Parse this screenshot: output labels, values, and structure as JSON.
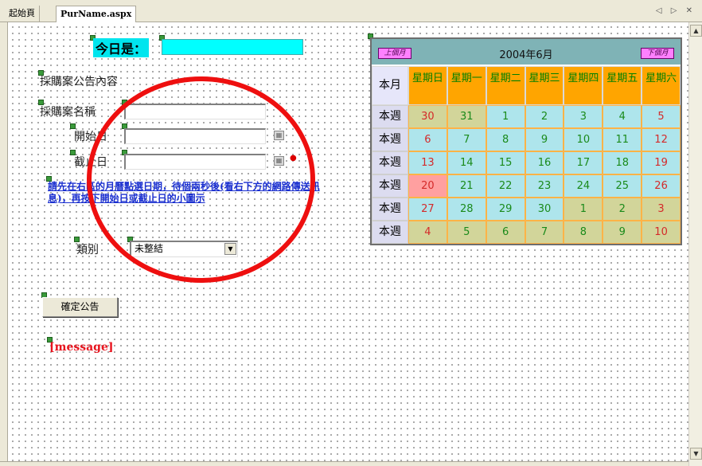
{
  "tabs": {
    "start": "起始頁",
    "active": "PurName.aspx",
    "controls": [
      "◁",
      "▷",
      "✕"
    ]
  },
  "form": {
    "today_label": "今日是：",
    "announcement_label": "採購案公告內容",
    "case_name_label": "採購案名稱",
    "start_date_label": "開始日",
    "end_date_label": "截止日",
    "hint_text": "請先在右區的月曆點選日期，待個兩秒後(看右下方的網路傳送訊息)，再按下開始日或截止日的小圖示",
    "category_label": "類別",
    "category_selected": "未整結",
    "confirm_button": "確定公告",
    "message": "[message]"
  },
  "icons": {
    "calendar_icon": "calendar-icon",
    "dropdown_arrow": "▼"
  },
  "calendar": {
    "prev_label": "上個月",
    "next_label": "下個月",
    "title": "2004年6月",
    "corner_label": "本月",
    "week_label": "本週",
    "weekday_headers": [
      "星期日",
      "星期一",
      "星期二",
      "星期三",
      "星期四",
      "星期五",
      "星期六"
    ],
    "weeks": [
      [
        {
          "d": "30",
          "cur": false
        },
        {
          "d": "31",
          "cur": false
        },
        {
          "d": "1",
          "cur": true
        },
        {
          "d": "2",
          "cur": true
        },
        {
          "d": "3",
          "cur": true
        },
        {
          "d": "4",
          "cur": true
        },
        {
          "d": "5",
          "cur": true
        }
      ],
      [
        {
          "d": "6",
          "cur": true
        },
        {
          "d": "7",
          "cur": true
        },
        {
          "d": "8",
          "cur": true
        },
        {
          "d": "9",
          "cur": true
        },
        {
          "d": "10",
          "cur": true
        },
        {
          "d": "11",
          "cur": true
        },
        {
          "d": "12",
          "cur": true
        }
      ],
      [
        {
          "d": "13",
          "cur": true
        },
        {
          "d": "14",
          "cur": true
        },
        {
          "d": "15",
          "cur": true
        },
        {
          "d": "16",
          "cur": true
        },
        {
          "d": "17",
          "cur": true
        },
        {
          "d": "18",
          "cur": true
        },
        {
          "d": "19",
          "cur": true
        }
      ],
      [
        {
          "d": "20",
          "cur": true,
          "today": true
        },
        {
          "d": "21",
          "cur": true
        },
        {
          "d": "22",
          "cur": true
        },
        {
          "d": "23",
          "cur": true
        },
        {
          "d": "24",
          "cur": true
        },
        {
          "d": "25",
          "cur": true
        },
        {
          "d": "26",
          "cur": true
        }
      ],
      [
        {
          "d": "27",
          "cur": true
        },
        {
          "d": "28",
          "cur": true
        },
        {
          "d": "29",
          "cur": true
        },
        {
          "d": "30",
          "cur": true
        },
        {
          "d": "1",
          "cur": false
        },
        {
          "d": "2",
          "cur": false
        },
        {
          "d": "3",
          "cur": false
        }
      ],
      [
        {
          "d": "4",
          "cur": false
        },
        {
          "d": "5",
          "cur": false
        },
        {
          "d": "6",
          "cur": false
        },
        {
          "d": "7",
          "cur": false
        },
        {
          "d": "8",
          "cur": false
        },
        {
          "d": "9",
          "cur": false
        },
        {
          "d": "10",
          "cur": false
        }
      ]
    ]
  },
  "colors": {
    "today_highlight": "#00ffff",
    "weekday_header_bg": "#ffa500",
    "current_month_bg": "#aee5ec",
    "other_month_bg": "#d2d59a",
    "annotation_circle": "#ee0f0f",
    "message_red": "#e8141e",
    "hint_blue": "#1a2fcf"
  }
}
